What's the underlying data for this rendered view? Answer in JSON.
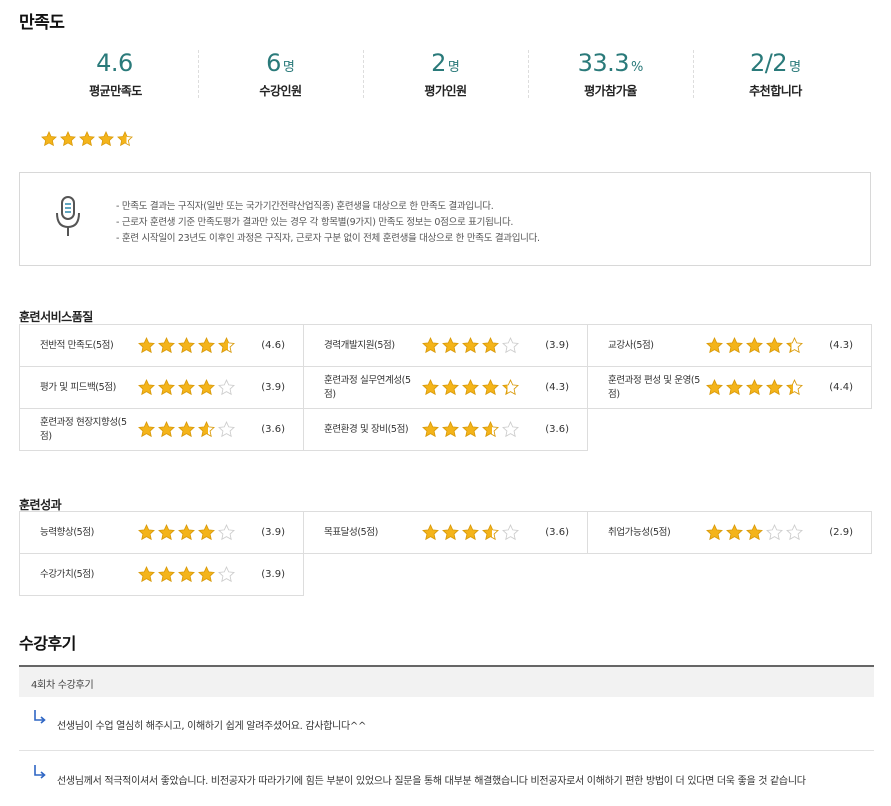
{
  "satisfaction": {
    "title": "만족도",
    "summary": [
      {
        "value": "4.6",
        "unit": "",
        "label": "평균만족도"
      },
      {
        "value": "6",
        "unit": "명",
        "label": "수강인원"
      },
      {
        "value": "2",
        "unit": "명",
        "label": "평가인원"
      },
      {
        "value": "33.3",
        "unit": "%",
        "label": "평가참가율"
      },
      {
        "value": "2/2",
        "unit": "명",
        "label": "추천합니다"
      }
    ],
    "overall_rating": 4.6,
    "notice_icon": "microphone-icon",
    "notice_lines": [
      "- 만족도 결과는 구직자(일반 또는 국가기간전략산업직종) 훈련생을 대상으로 한 만족도 결과입니다.",
      "- 근로자 훈련생 기준 만족도평가 결과만 있는 경우 각 항목별(9가지) 만족도 정보는 0점으로 표기됩니다.",
      "- 훈련 시작일이 23년도 이후인 과정은 구직자, 근로자 구분 없이 전체 훈련생을 대상으로 한 만족도 결과입니다."
    ]
  },
  "service_quality": {
    "title": "훈련서비스품질",
    "items": [
      {
        "name": "전반적 만족도(5점)",
        "rating": 4.6,
        "score": "(4.6)"
      },
      {
        "name": "경력개발지원(5점)",
        "rating": 3.9,
        "score": "(3.9)"
      },
      {
        "name": "교강사(5점)",
        "rating": 4.3,
        "score": "(4.3)"
      },
      {
        "name": "평가 및 피드백(5점)",
        "rating": 3.9,
        "score": "(3.9)"
      },
      {
        "name": "훈련과정 실무연계성(5점)",
        "rating": 4.3,
        "score": "(4.3)"
      },
      {
        "name": "훈련과정 편성 및 운영(5점)",
        "rating": 4.4,
        "score": "(4.4)"
      },
      {
        "name": "훈련과정 현장지향성(5점)",
        "rating": 3.6,
        "score": "(3.6)"
      },
      {
        "name": "훈련환경 및 장비(5점)",
        "rating": 3.6,
        "score": "(3.6)"
      }
    ]
  },
  "outcomes": {
    "title": "훈련성과",
    "items": [
      {
        "name": "능력향상(5점)",
        "rating": 3.9,
        "score": "(3.9)"
      },
      {
        "name": "목표달성(5점)",
        "rating": 3.6,
        "score": "(3.6)"
      },
      {
        "name": "취업가능성(5점)",
        "rating": 2.9,
        "score": "(2.9)"
      },
      {
        "name": "수강가치(5점)",
        "rating": 3.9,
        "score": "(3.9)"
      }
    ]
  },
  "reviews": {
    "title": "수강후기",
    "session_label": "4회차 수강후기",
    "items": [
      {
        "text": "선생님이 수업 열심히 해주시고, 이해하기 쉽게 알려주셨어요. 감사합니다^^"
      },
      {
        "text": "선생님께서 적극적이셔서 좋았습니다. 비전공자가 따라가기에 힘든 부분이 있었으나 질문을 통해 대부분 해결했습니다 비전공자로서 이해하기 편한 방법이 더 있다면 더욱 좋을 것 같습니다"
      }
    ]
  },
  "colors": {
    "accent": "#2a7a7a",
    "star_filled": "#f4b41a",
    "star_empty": "#cccccc"
  }
}
